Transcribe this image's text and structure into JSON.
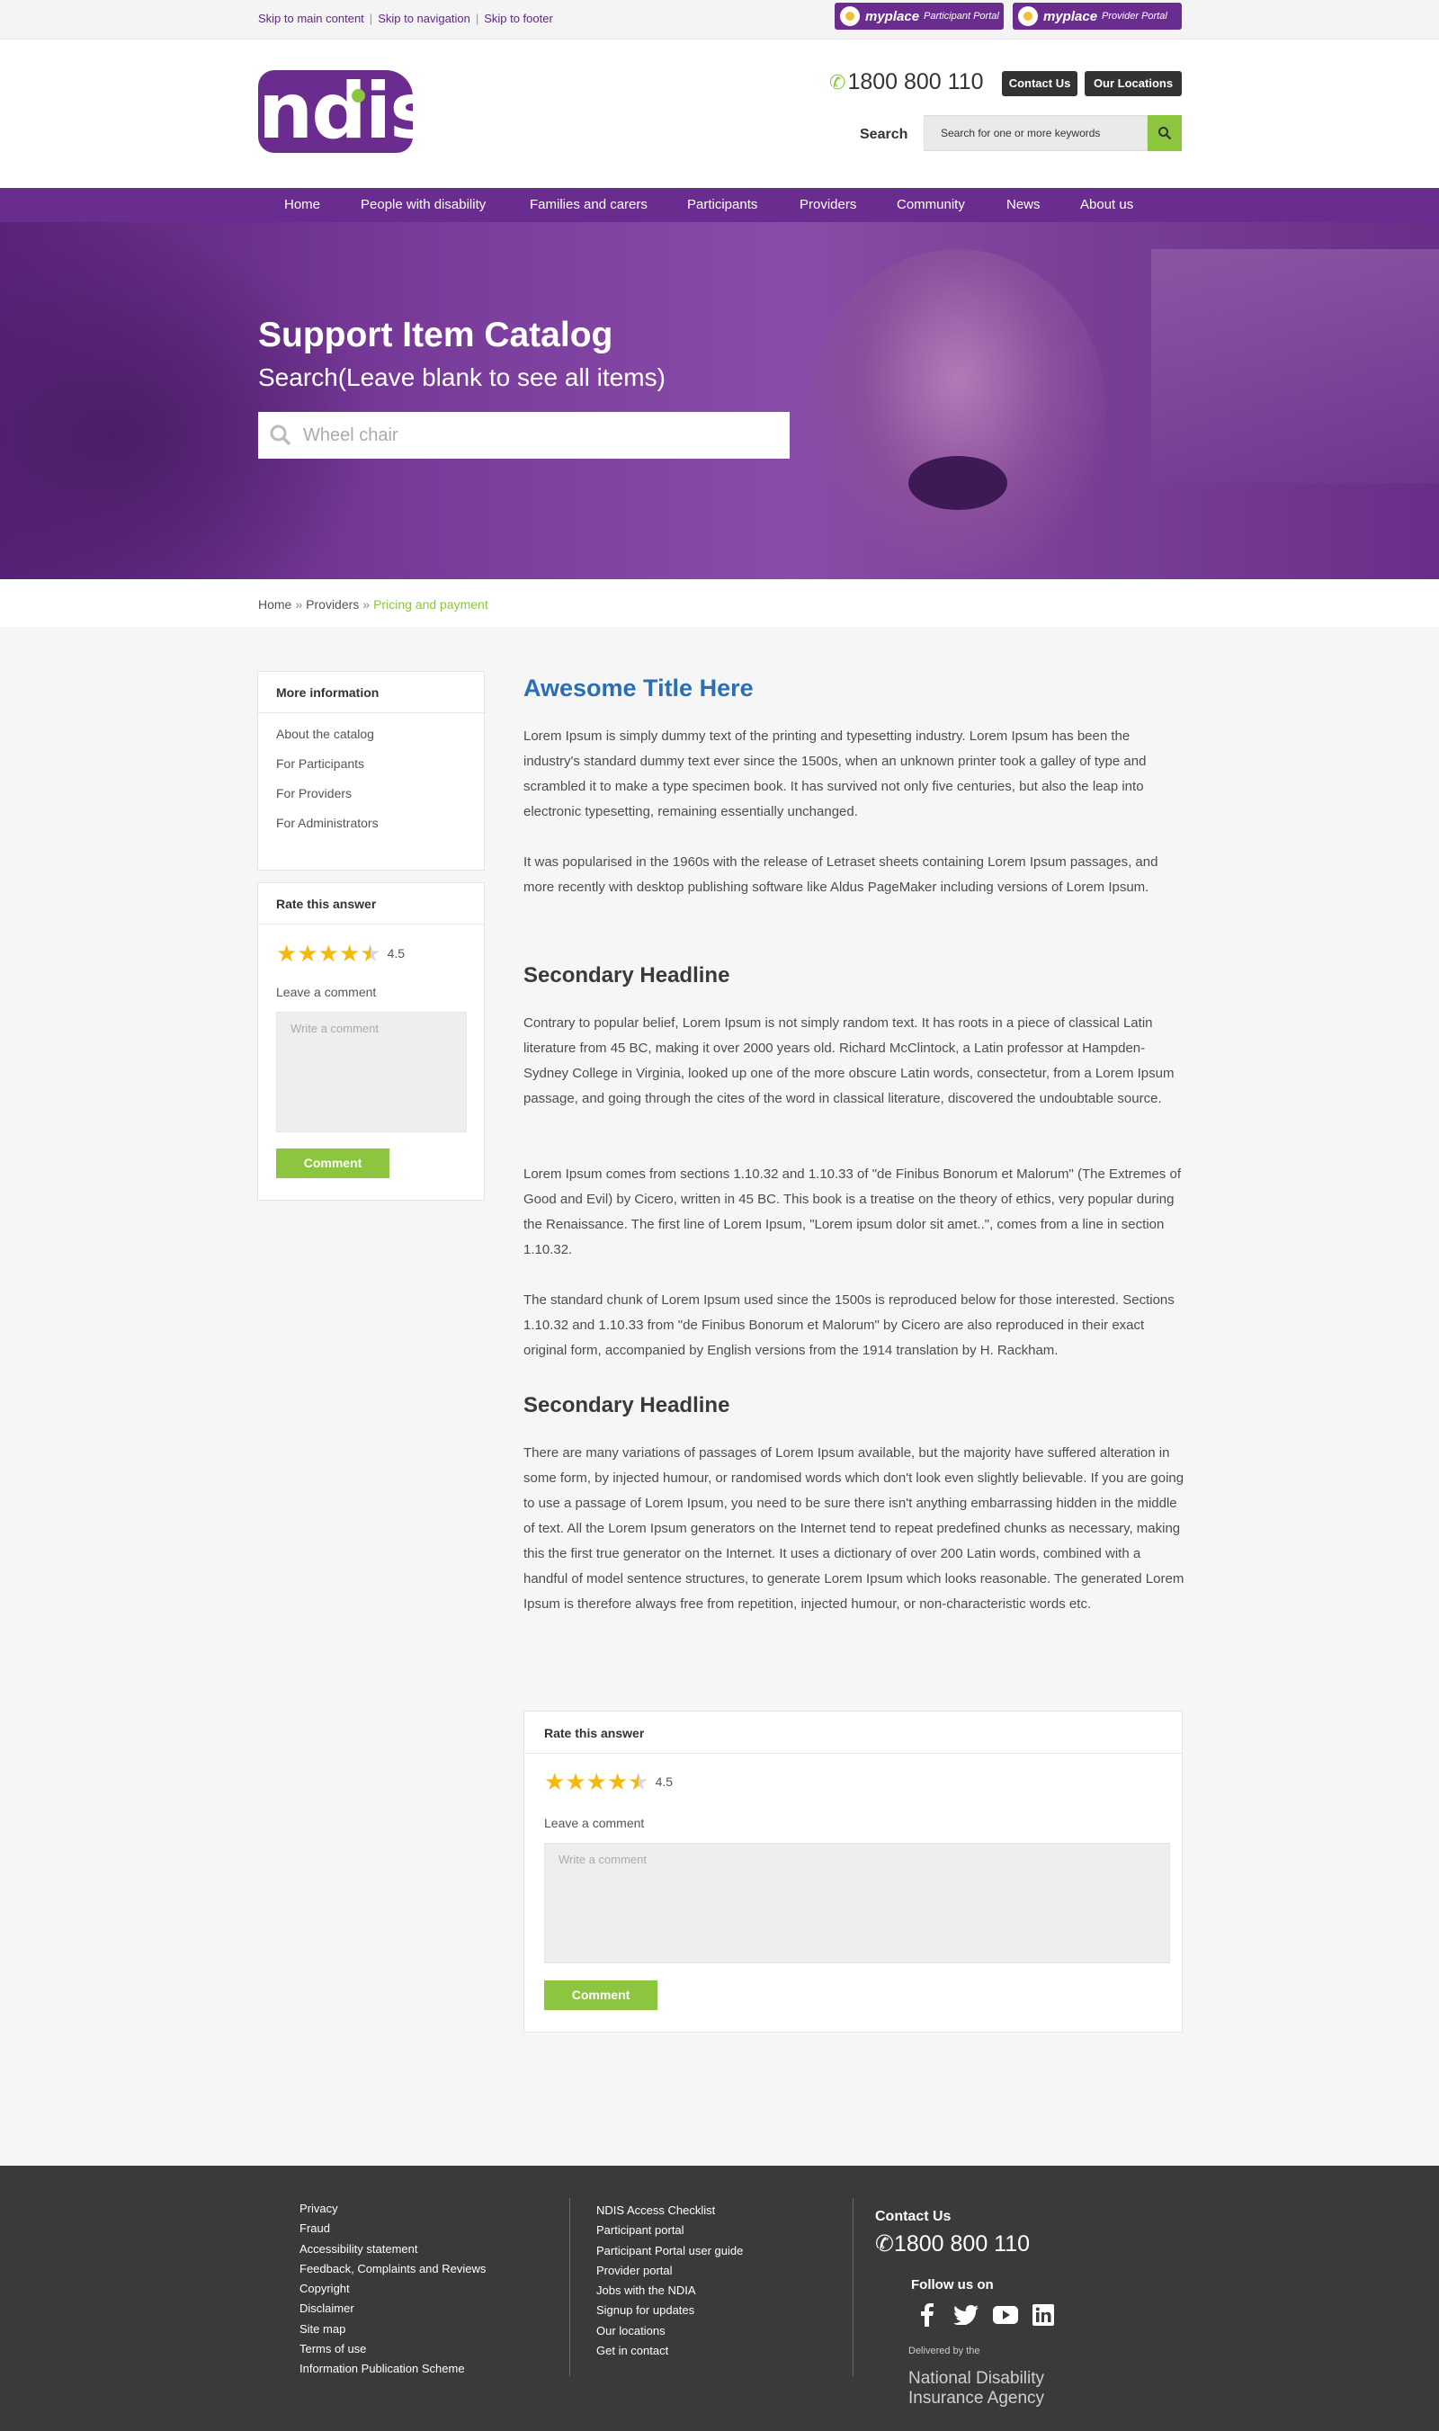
{
  "skip_links": [
    "Skip to main content",
    "Skip to navigation",
    "Skip to footer"
  ],
  "portals": [
    {
      "name": "myplace",
      "sub": "Participant Portal"
    },
    {
      "name": "myplace",
      "sub": "Provider Portal"
    }
  ],
  "header": {
    "logo_text": "ndis",
    "phone": "1800 800 110",
    "contact_us": "Contact Us",
    "our_locations": "Our Locations",
    "search_label": "Search",
    "search_placeholder": "Search for one or more keywords"
  },
  "nav": [
    "Home",
    "People with disability",
    "Families and carers",
    "Participants",
    "Providers",
    "Community",
    "News",
    "About us"
  ],
  "hero": {
    "title": "Support Item Catalog",
    "subtitle": "Search(Leave blank to see all items)",
    "search_placeholder": "Wheel chair"
  },
  "breadcrumb": [
    "Home",
    "Providers",
    "Pricing and payment"
  ],
  "sidebar": {
    "more_info_title": "More information",
    "links": [
      "About the catalog",
      "For Participants",
      "For Providers",
      "For Administrators"
    ],
    "rate_title": "Rate this answer",
    "rating": "4.5",
    "rating_value": 4.5,
    "comment_label": "Leave a comment",
    "comment_placeholder": "Write a comment",
    "comment_button": "Comment"
  },
  "article": {
    "title": "Awesome Title Here",
    "p1": "Lorem Ipsum is simply dummy text of the printing and typesetting industry. Lorem Ipsum has been the industry's standard dummy text ever since the 1500s, when an unknown printer took a galley of type and scrambled it to make a type specimen book. It has survived not only five centuries, but also the leap into electronic typesetting, remaining essentially unchanged.",
    "p2": "It was popularised in the 1960s with the release of Letraset sheets containing Lorem Ipsum passages, and more recently with desktop publishing software like Aldus PageMaker including versions of Lorem Ipsum.",
    "h2a": "Secondary Headline",
    "p3": "Contrary to popular belief, Lorem Ipsum is not simply random text. It has roots in a piece of classical Latin literature from 45 BC, making it over 2000 years old. Richard McClintock, a Latin professor at Hampden-Sydney College in Virginia, looked up one of the more obscure Latin words, consectetur, from a Lorem Ipsum passage, and going through the cites of the word in classical literature, discovered the undoubtable source.",
    "p4": "Lorem Ipsum comes from sections 1.10.32 and 1.10.33 of \"de Finibus Bonorum et Malorum\" (The Extremes of Good and Evil) by Cicero, written in 45 BC. This book is a treatise on the theory of ethics, very popular during the Renaissance. The first line of Lorem Ipsum, \"Lorem ipsum dolor sit amet..\", comes from a line in section 1.10.32.",
    "p5": "The standard chunk of Lorem Ipsum used since the 1500s is reproduced below for those interested. Sections 1.10.32 and 1.10.33 from \"de Finibus Bonorum et Malorum\" by Cicero are also reproduced in their exact original form, accompanied by English versions from the 1914 translation by H. Rackham.",
    "h2b": "Secondary Headline",
    "p6": "There are many variations of passages of Lorem Ipsum available, but the majority have suffered alteration in some form, by injected humour, or randomised words which don't look even slightly believable. If you are going to use a passage of Lorem Ipsum, you need to be sure there isn't anything embarrassing hidden in the middle of text. All the Lorem Ipsum generators on the Internet tend to repeat predefined chunks as necessary, making this the first true generator on the Internet. It uses a dictionary of over 200 Latin words, combined with a handful of model sentence structures, to generate Lorem Ipsum which looks reasonable. The generated Lorem Ipsum is therefore always free from repetition, injected humour, or non-characteristic words etc."
  },
  "bottom_rate": {
    "title": "Rate this answer",
    "rating": "4.5",
    "rating_value": 4.5,
    "comment_label": "Leave a comment",
    "comment_placeholder": "Write a comment",
    "comment_button": "Comment"
  },
  "footer": {
    "col1": [
      "Privacy",
      "Fraud",
      "Accessibility statement",
      "Feedback, Complaints and Reviews",
      "Copyright",
      "Disclaimer",
      "Site map",
      "Terms of use",
      "Information Publication Scheme"
    ],
    "col2": [
      "NDIS Access Checklist",
      "Participant portal",
      "Participant Portal user guide",
      "Provider portal",
      "Jobs with the NDIA",
      "Signup for updates",
      "Our locations",
      "Get in contact"
    ],
    "contact_title": "Contact Us",
    "phone": "1800 800 110",
    "follow": "Follow us on",
    "social": [
      "facebook-icon",
      "twitter-icon",
      "youtube-icon",
      "linkedin-icon"
    ],
    "delivered_by": "Delivered by the",
    "agency": [
      "National Disability",
      "Insurance Agency"
    ]
  },
  "colors": {
    "brand_purple": "#6b2c8f",
    "accent_green": "#8cc63f",
    "title_blue": "#2a6fb3",
    "footer_bg": "#3a3a3a",
    "star": "#f5b90e"
  }
}
